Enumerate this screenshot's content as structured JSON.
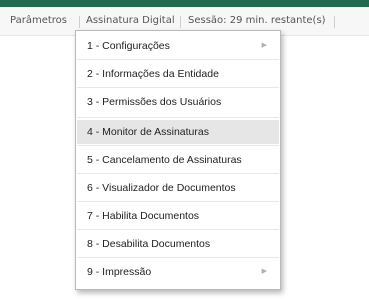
{
  "menubar": {
    "items": [
      {
        "label": "Parâmetros"
      },
      {
        "label": "Assinatura Digital"
      },
      {
        "label": "Sessão: 29 min. restante(s)"
      }
    ]
  },
  "dropdown": {
    "items": [
      {
        "label": "1 - Configurações",
        "submenu": true
      },
      {
        "label": "2 - Informações da Entidade"
      },
      {
        "label": "3 - Permissões dos Usuários"
      },
      {
        "label": "4 - Monitor de Assinaturas",
        "highlighted": true
      },
      {
        "label": "5 - Cancelamento de Assinaturas"
      },
      {
        "label": "6 - Visualizador de Documentos"
      },
      {
        "label": "7 - Habilita Documentos"
      },
      {
        "label": "8 - Desabilita Documentos"
      },
      {
        "label": "9 - Impressão",
        "submenu": true
      }
    ],
    "submenu_arrow_icon": "triangle-right"
  },
  "colors": {
    "top_bar": "#1e6b50",
    "menubar_bg": "#f7f7f7",
    "hover_bg": "#e6e6e6"
  }
}
